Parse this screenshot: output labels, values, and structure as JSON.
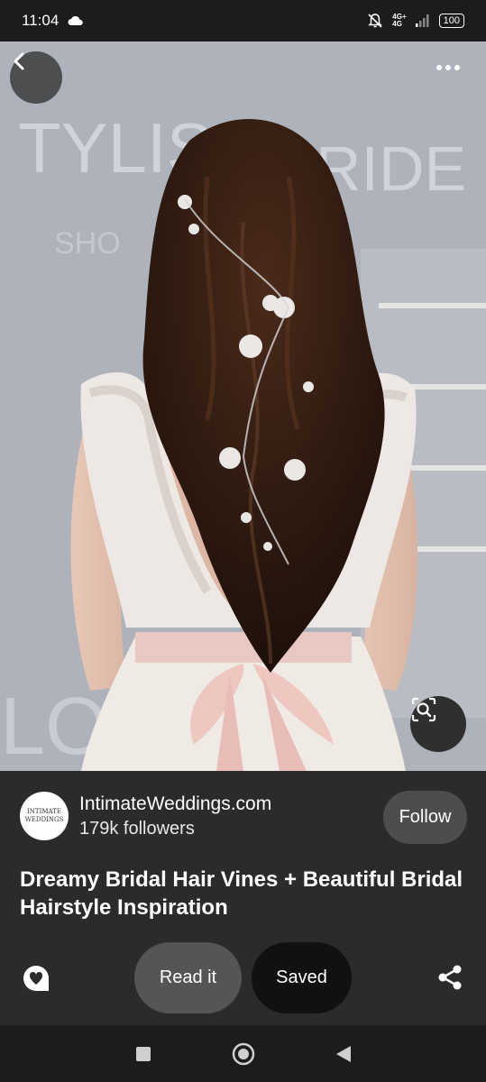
{
  "status_bar": {
    "time": "11:04",
    "network_top": "4G+",
    "network_bottom": "4G",
    "battery": "100",
    "icons": [
      "cloud-icon",
      "mute-icon",
      "signal-icon",
      "battery-icon"
    ]
  },
  "hero": {
    "image": "bride-hair-vine-photo",
    "back_icon": "chevron-left-icon",
    "more_icon": "more-horizontal-icon",
    "lens_icon": "visual-search-icon"
  },
  "pin": {
    "source": "IntimateWeddings.com",
    "followers": "179k followers",
    "avatar_text_top": "INTIMATE",
    "avatar_text_bottom": "WEDDINGS",
    "follow_label": "Follow",
    "title": "Dreamy Bridal Hair Vines + Beautiful Bridal Hairstyle Inspiration"
  },
  "actions": {
    "read_label": "Read it",
    "saved_label": "Saved",
    "comment_icon": "comment-heart-icon",
    "share_icon": "share-icon"
  },
  "nav": {
    "icons": [
      "recents-square-icon",
      "home-circle-icon",
      "back-triangle-icon"
    ]
  },
  "colors": {
    "background": "#2b2b2b",
    "status_bar": "#1c1c1c",
    "follow_button": "#4d4d4d",
    "read_button": "#555555",
    "saved_button": "#111111"
  }
}
